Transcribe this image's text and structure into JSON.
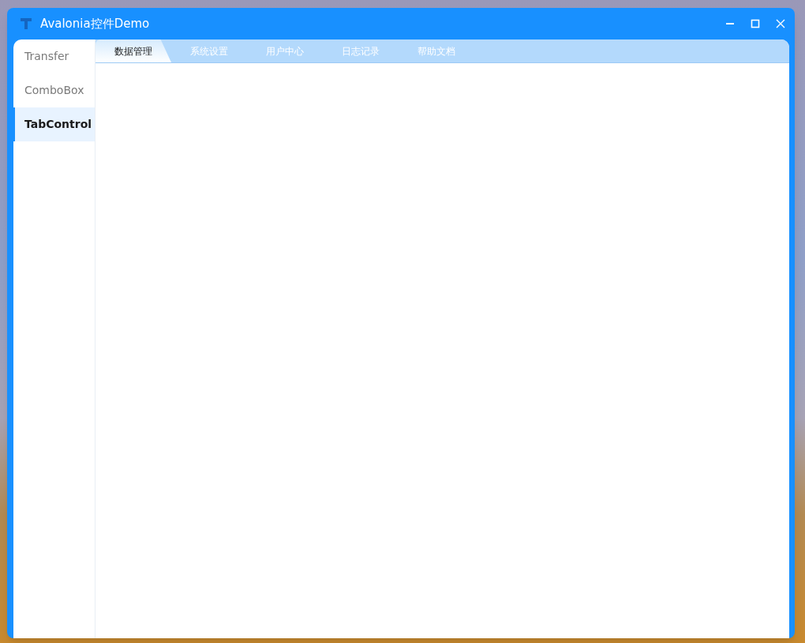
{
  "window": {
    "title": "Avalonia控件Demo"
  },
  "sidebar": {
    "items": [
      {
        "label": "Transfer",
        "selected": false
      },
      {
        "label": "ComboBox",
        "selected": false
      },
      {
        "label": "TabControl",
        "selected": true
      }
    ]
  },
  "tabs": [
    {
      "label": "数据管理",
      "selected": true
    },
    {
      "label": "系统设置",
      "selected": false
    },
    {
      "label": "用户中心",
      "selected": false
    },
    {
      "label": "日志记录",
      "selected": false
    },
    {
      "label": "帮助文档",
      "selected": false
    }
  ]
}
